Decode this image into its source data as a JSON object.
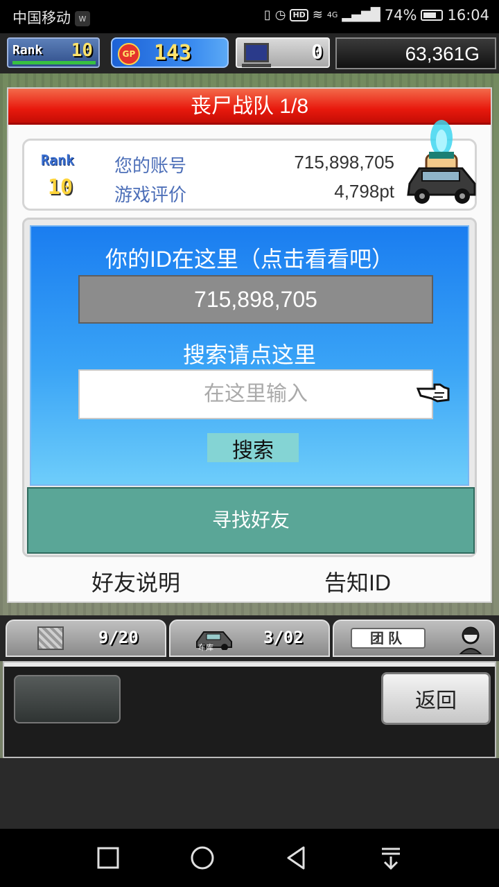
{
  "status_bar": {
    "carrier": "中国移动",
    "carrier_badge": "w",
    "network": "4G",
    "battery": "74%",
    "time": "16:04"
  },
  "hud": {
    "rank_label": "Rank",
    "rank_value": "10",
    "gp_icon": "GP",
    "gp_value": "143",
    "pc_value": "0",
    "money": "63,361G"
  },
  "modal": {
    "title": "丧尸战队 1/8",
    "rank_label": "Rank",
    "rank_value": "10",
    "account_label": "您的账号",
    "account_value": "715,898,705",
    "rating_label": "游戏评价",
    "rating_value": "4,798pt",
    "id_title": "你的ID在这里（点击看看吧）",
    "id_value": "715,898,705",
    "search_title": "搜索请点这里",
    "search_placeholder": "在这里输入",
    "search_button": "搜索",
    "find_friend": "寻找好友",
    "friend_help": "好友说明",
    "tell_id": "告知ID"
  },
  "bottom_bar": {
    "crate_count": "9/20",
    "garage_label": "车库",
    "garage_count": "3/02",
    "team_label": "团队",
    "back_button": "返回"
  },
  "colors": {
    "header_red": "#e8190d",
    "panel_blue": "#1a7df0",
    "find_friend_green": "#5aa697",
    "search_button_teal": "#84d4d4"
  },
  "icons": [
    "signal-icon",
    "alarm-icon",
    "hd-icon",
    "wifi-icon",
    "battery-icon",
    "gp-coin-icon",
    "computer-icon",
    "car-avatar-icon",
    "pointer-hand-icon",
    "crate-icon",
    "garage-car-icon",
    "person-icon",
    "recent-apps-icon",
    "home-icon",
    "back-icon",
    "notification-pull-icon"
  ]
}
